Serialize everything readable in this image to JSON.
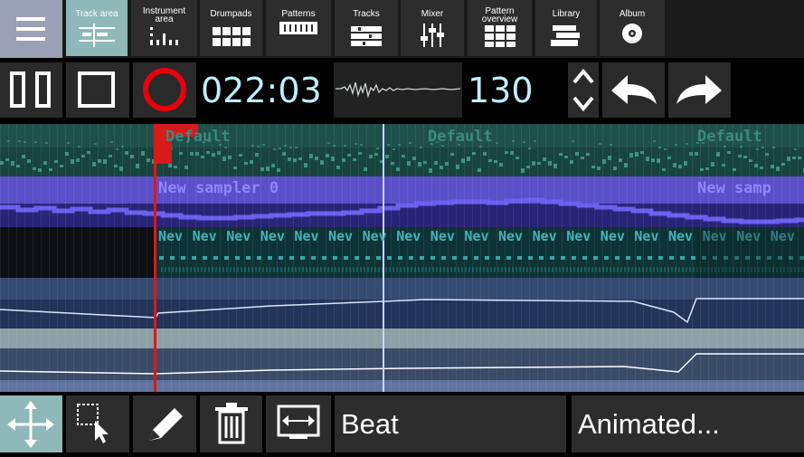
{
  "nav": {
    "items": [
      {
        "label": "Track area",
        "icon": "track-area-icon"
      },
      {
        "label": "Instrument area",
        "icon": "instrument-area-icon"
      },
      {
        "label": "Drumpads",
        "icon": "drumpads-icon"
      },
      {
        "label": "Patterns",
        "icon": "patterns-icon"
      },
      {
        "label": "Tracks",
        "icon": "tracks-icon"
      },
      {
        "label": "Mixer",
        "icon": "mixer-icon"
      },
      {
        "label": "Pattern overview",
        "icon": "pattern-overview-icon"
      },
      {
        "label": "Library",
        "icon": "library-icon"
      },
      {
        "label": "Album",
        "icon": "album-icon"
      }
    ],
    "instrument_line1": "Instrument",
    "instrument_line2": "area",
    "overview_line1": "Pattern",
    "overview_line2": "overview"
  },
  "transport": {
    "time": "022:03",
    "tempo": "130"
  },
  "tracks": {
    "pattern_label": "Default",
    "sampler_label": "New sampler 0",
    "sampler_label_cut": "New samp",
    "note_label": "Nev"
  },
  "bottom": {
    "beat_label": "Beat",
    "animated_label": "Animated..."
  },
  "colors": {
    "nav_active": "#8fb8b8",
    "menu_bg": "#9aa0b5",
    "record": "#e8000b",
    "digits": "#bfefff",
    "playhead": "#d81a1a",
    "sampler_track": "#5a4fc8"
  }
}
